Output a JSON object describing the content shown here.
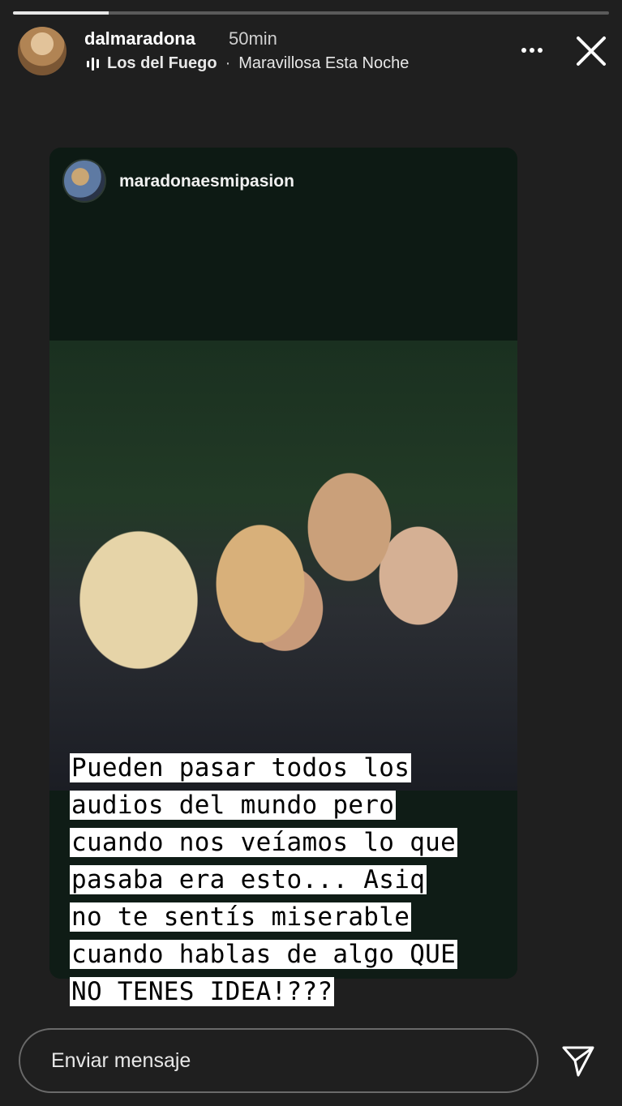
{
  "story": {
    "progress_fraction": 0.16,
    "username": "dalmaradona",
    "time": "50min",
    "music": {
      "artist": "Los del Fuego",
      "separator": "·",
      "song": "Maravillosa Esta Noche"
    }
  },
  "repost": {
    "username": "maradonaesmipasion",
    "caption_lines": [
      "Pueden pasar todos los",
      "audios del mundo pero",
      "cuando nos veíamos lo que",
      "pasaba era esto... Asiq",
      "no te sentís miserable",
      "cuando hablas de algo QUE",
      "NO TENES IDEA!???"
    ]
  },
  "reply": {
    "placeholder": "Enviar mensaje"
  },
  "icons": {
    "music": "audio-bars-icon",
    "more": "more-options-icon",
    "close": "close-icon",
    "send": "send-icon"
  },
  "colors": {
    "background": "#1f1f1f",
    "repost_card": "#0d1a14",
    "caption_highlight": "#ffffff"
  }
}
